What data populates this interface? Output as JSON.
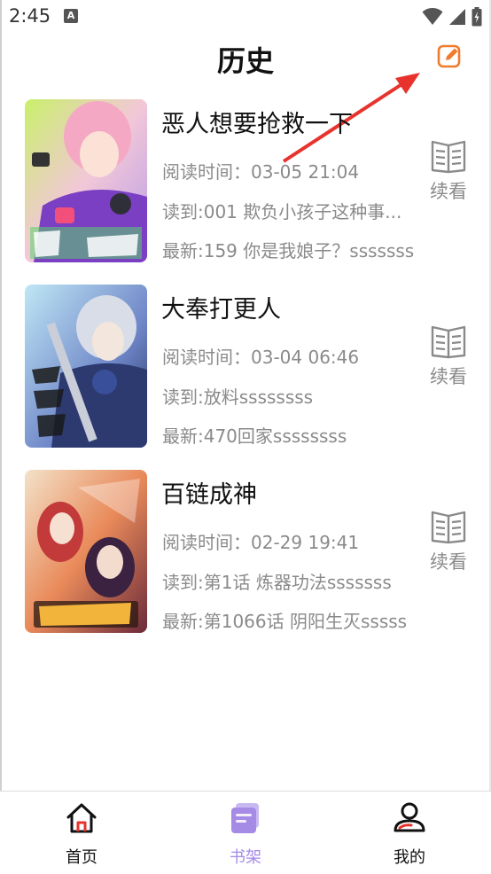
{
  "status_bar": {
    "time": "2:45",
    "notif": "A"
  },
  "header": {
    "title": "历史",
    "edit_icon": "edit-pencil-icon"
  },
  "colors": {
    "accent": "#f07b2c",
    "annotation": "#e8332d",
    "active_tab": "#a58be6",
    "meta_text": "#8a8a8a"
  },
  "history": [
    {
      "title": "恶人想要抢救一下",
      "read_time": "阅读时间：03-05 21:04",
      "read_to": "读到:001 欺负小孩子这种事...",
      "latest": "最新:159 你是我娘子？sssssss",
      "continue_label": "续看"
    },
    {
      "title": "大奉打更人",
      "read_time": "阅读时间：03-04 06:46",
      "read_to": "读到:放料ssssssss",
      "latest": "最新:470回家ssssssss",
      "continue_label": "续看"
    },
    {
      "title": "百链成神",
      "read_time": "阅读时间：02-29 19:41",
      "read_to": "读到:第1话 炼器功法sssssss",
      "latest": "最新:第1066话 阴阳生灭sssss",
      "continue_label": "续看"
    }
  ],
  "tabbar": [
    {
      "label": "首页",
      "icon": "home-icon",
      "active": false
    },
    {
      "label": "书架",
      "icon": "bookshelf-icon",
      "active": true
    },
    {
      "label": "我的",
      "icon": "profile-icon",
      "active": false
    }
  ]
}
